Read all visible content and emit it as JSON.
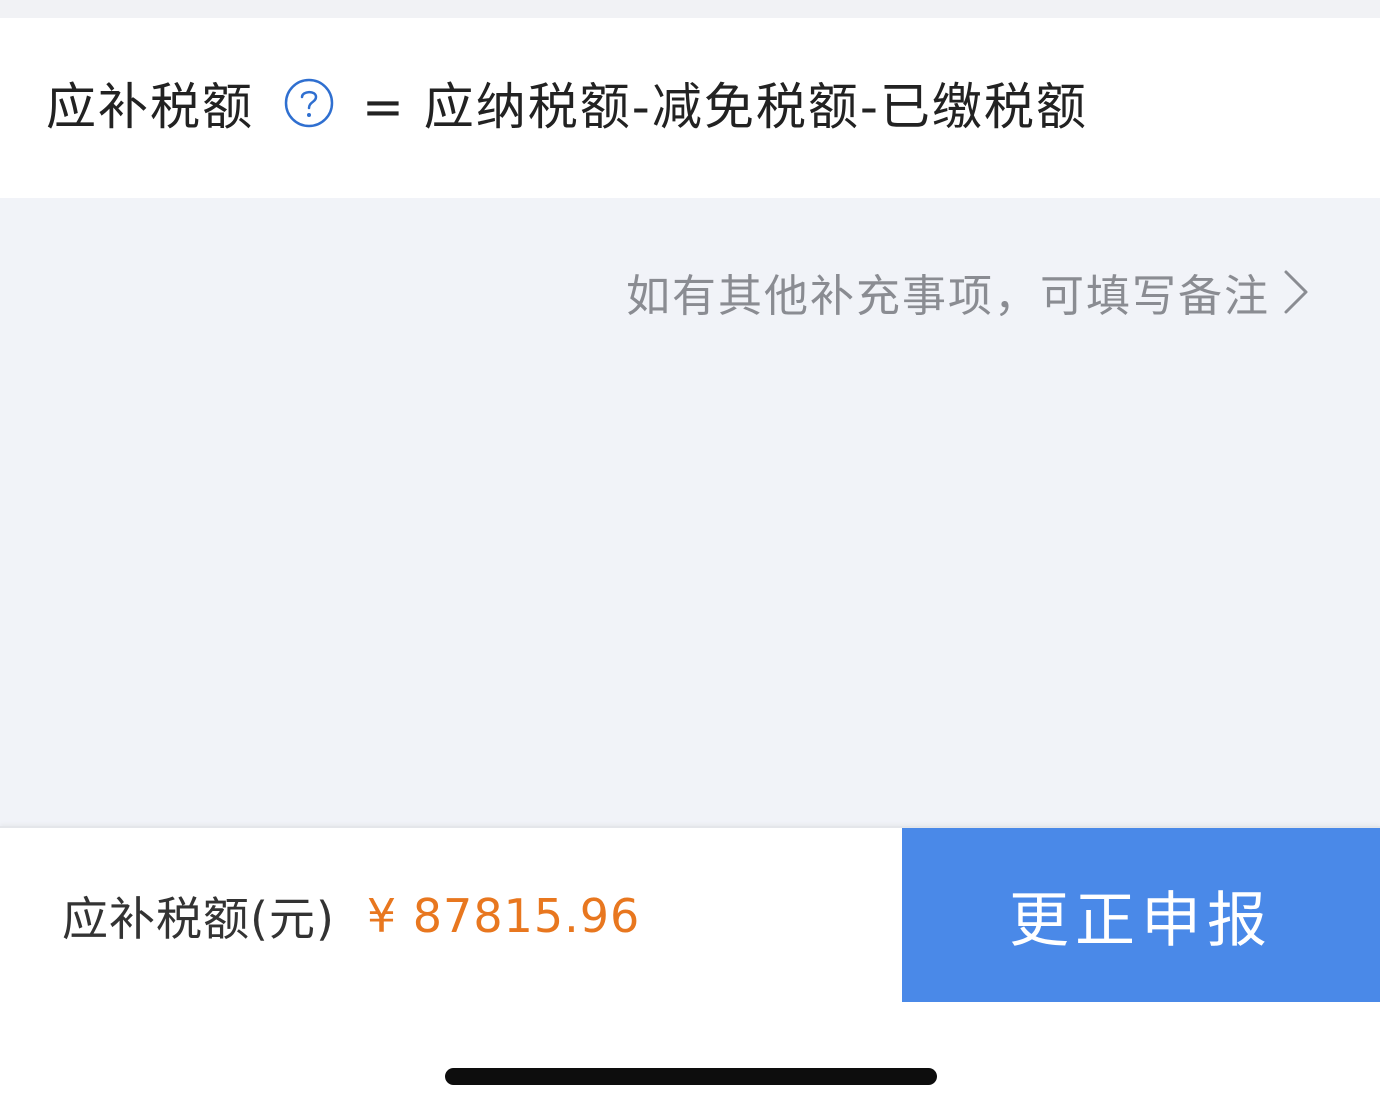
{
  "formula": {
    "label": "应补税额",
    "help_icon": "question-circle-icon",
    "expression": "= 应纳税额-减免税额-已缴税额"
  },
  "remark": {
    "text": "如有其他补充事项，可填写备注",
    "chevron_icon": "chevron-right-icon"
  },
  "footer": {
    "tax_label": "应补税额(元)",
    "tax_amount": "¥ 87815.96",
    "submit_label": "更正申报"
  },
  "colors": {
    "accent_blue": "#4a89e8",
    "amount_orange": "#e8771f",
    "help_icon_blue": "#2f6fd0"
  }
}
